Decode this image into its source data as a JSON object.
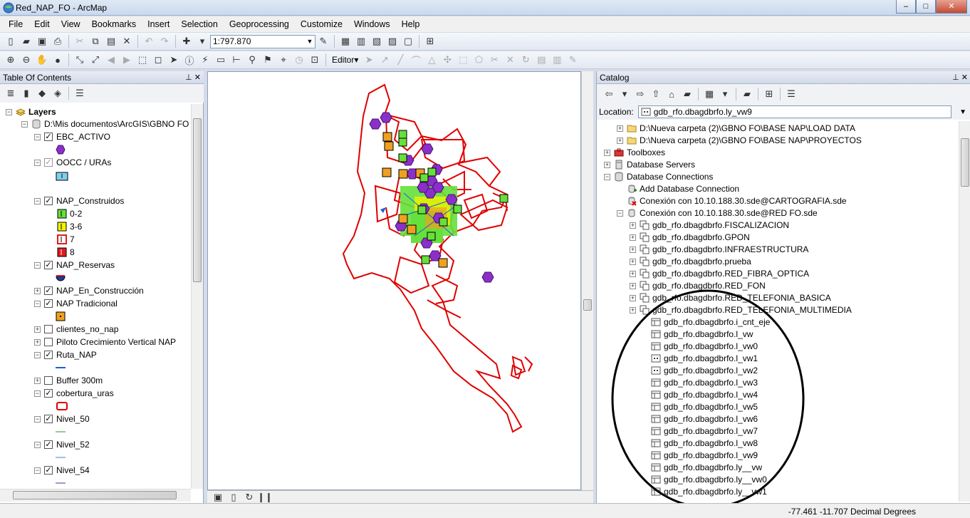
{
  "window": {
    "title": "Red_NAP_FO - ArcMap",
    "minimize": "‒",
    "maximize": "□",
    "close": "✕"
  },
  "menu": [
    "File",
    "Edit",
    "View",
    "Bookmarks",
    "Insert",
    "Selection",
    "Geoprocessing",
    "Customize",
    "Windows",
    "Help"
  ],
  "toolbar": {
    "scale": "1:797.870",
    "editor_label": "Editor▾"
  },
  "toc": {
    "title": "Table Of Contents",
    "root_label": "Layers",
    "datasource": "D:\\Mis documentos\\ArcGIS\\GBNO FO",
    "layers": [
      {
        "name": "EBC_ACTIVO",
        "checked": true
      },
      {
        "name": "OOCC / URAs",
        "checked": true
      },
      {
        "name": "NAP_Construidos",
        "checked": true
      },
      {
        "name": "NAP_Reservas",
        "checked": true
      },
      {
        "name": "NAP_En_Construcción",
        "checked": true
      },
      {
        "name": "NAP Tradicional",
        "checked": true
      },
      {
        "name": "clientes_no_nap",
        "checked": false
      },
      {
        "name": "Piloto Crecimiento Vertical NAP",
        "checked": false
      },
      {
        "name": "Ruta_NAP",
        "checked": true
      },
      {
        "name": "Buffer 300m",
        "checked": false
      },
      {
        "name": "cobertura_uras",
        "checked": true
      },
      {
        "name": "Nivel_50",
        "checked": true
      },
      {
        "name": "Nivel_52",
        "checked": true
      },
      {
        "name": "Nivel_54",
        "checked": true
      }
    ],
    "nap_classes": [
      "0-2",
      "3-6",
      "7",
      "8"
    ],
    "colors": {
      "ebc": "#8b2fc9",
      "nap_green": "#66e03a",
      "nap_yellow": "#f2f200",
      "nap_red": "#e01b1b",
      "orange": "#f0a020",
      "route": "#1c5fd6",
      "uras": "#e00000"
    }
  },
  "catalog": {
    "title": "Catalog",
    "location_label": "Location:",
    "location_value": "gdb_rfo.dbagdbrfo.ly_vw9",
    "items": [
      "D:\\Nueva carpeta (2)\\GBNO FO\\BASE NAP\\LOAD DATA",
      "D:\\Nueva carpeta (2)\\GBNO FO\\BASE NAP\\PROYECTOS",
      "Toolboxes",
      "Database Servers",
      "Database Connections",
      "Add Database Connection",
      "Conexión con 10.10.188.30.sde@CARTOGRAFIA.sde",
      "Conexión con 10.10.188.30.sde@RED FO.sde",
      "gdb_rfo.dbagdbrfo.FISCALIZACION",
      "gdb_rfo.dbagdbrfo.GPON",
      "gdb_rfo.dbagdbrfo.INFRAESTRUCTURA",
      "gdb_rfo.dbagdbrfo.prueba",
      "gdb_rfo.dbagdbrfo.RED_FIBRA_OPTICA",
      "gdb_rfo.dbagdbrfo.RED_FON",
      "gdb_rfo.dbagdbrfo.RED_TELEFONIA_BASICA",
      "gdb_rfo.dbagdbrfo.RED_TELEFONIA_MULTIMEDIA",
      "gdb_rfo.dbagdbrfo.i_cnt_eje",
      "gdb_rfo.dbagdbrfo.l_vw",
      "gdb_rfo.dbagdbrfo.l_vw0",
      "gdb_rfo.dbagdbrfo.l_vw1",
      "gdb_rfo.dbagdbrfo.l_vw2",
      "gdb_rfo.dbagdbrfo.l_vw3",
      "gdb_rfo.dbagdbrfo.l_vw4",
      "gdb_rfo.dbagdbrfo.l_vw5",
      "gdb_rfo.dbagdbrfo.l_vw6",
      "gdb_rfo.dbagdbrfo.l_vw7",
      "gdb_rfo.dbagdbrfo.l_vw8",
      "gdb_rfo.dbagdbrfo.l_vw9",
      "gdb_rfo.dbagdbrfo.ly__vw",
      "gdb_rfo.dbagdbrfo.ly__vw0",
      "gdb_rfo.dbagdbrfo.ly__vw1"
    ]
  },
  "status": {
    "coords": "-77.461  -11.707 Decimal Degrees"
  }
}
